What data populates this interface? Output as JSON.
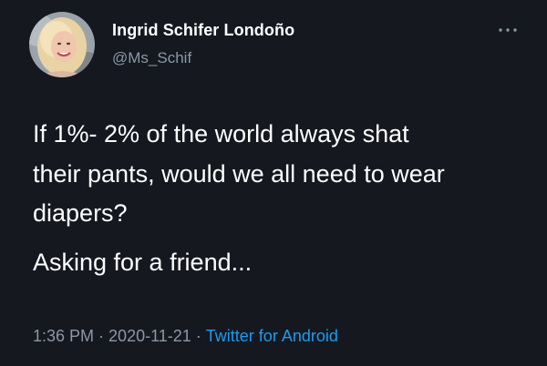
{
  "author": {
    "name": "Ingrid Schifer Londoño",
    "handle": "@Ms_Schif"
  },
  "tweet": {
    "lines": [
      "If 1%- 2% of the world always shat\ntheir pants, would we all need to wear\ndiapers?",
      "Asking for a friend..."
    ]
  },
  "meta": {
    "time": "1:36 PM",
    "date": "2020-11-21",
    "separator": "·",
    "source": "Twitter for Android"
  },
  "icons": {
    "more": "more-horizontal-icon",
    "avatar": "profile-photo"
  },
  "colors": {
    "background": "#15181f",
    "text": "#ffffff",
    "secondary": "#8b98a5",
    "link": "#1d9bf0"
  }
}
